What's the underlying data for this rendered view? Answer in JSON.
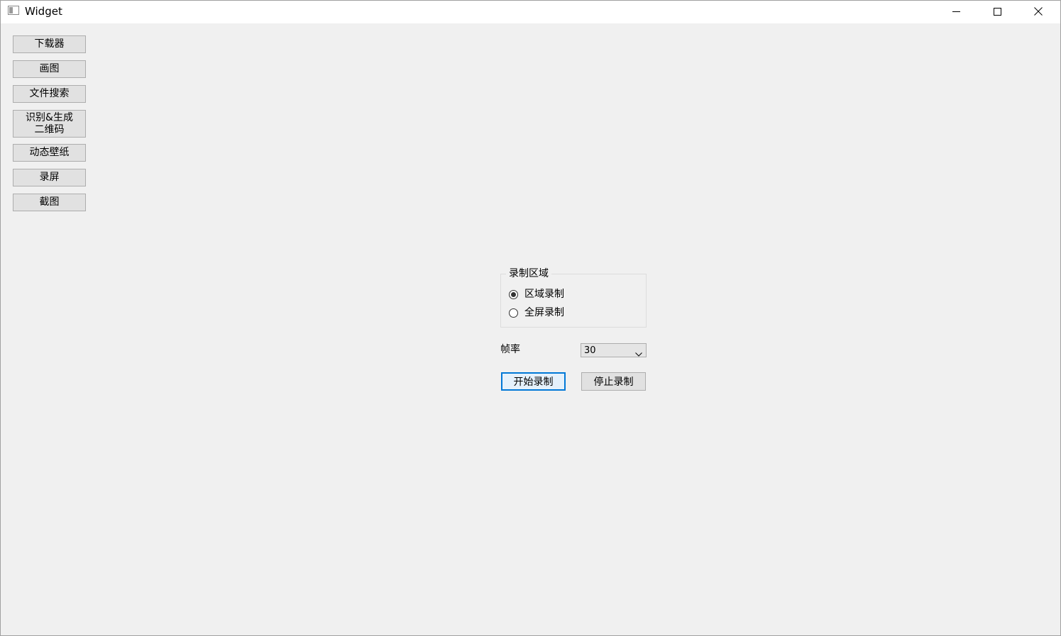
{
  "window": {
    "title": "Widget",
    "minimize_icon": "minimize-icon",
    "maximize_icon": "maximize-icon",
    "close_icon": "close-icon"
  },
  "sidebar": {
    "items": [
      {
        "label": "下载器"
      },
      {
        "label": "画图"
      },
      {
        "label": "文件搜索"
      },
      {
        "label": "识别&生成\n二维码"
      },
      {
        "label": "动态壁纸"
      },
      {
        "label": "录屏"
      },
      {
        "label": "截图"
      }
    ]
  },
  "recording": {
    "group_title": "录制区域",
    "options": [
      {
        "label": "区域录制",
        "checked": true
      },
      {
        "label": "全屏录制",
        "checked": false
      }
    ],
    "fps_label": "帧率",
    "fps_value": "30",
    "start_label": "开始录制",
    "stop_label": "停止录制"
  },
  "colors": {
    "focus_border": "#0078d7",
    "window_bg": "#f0f0f0",
    "button_bg": "#e1e1e1"
  }
}
